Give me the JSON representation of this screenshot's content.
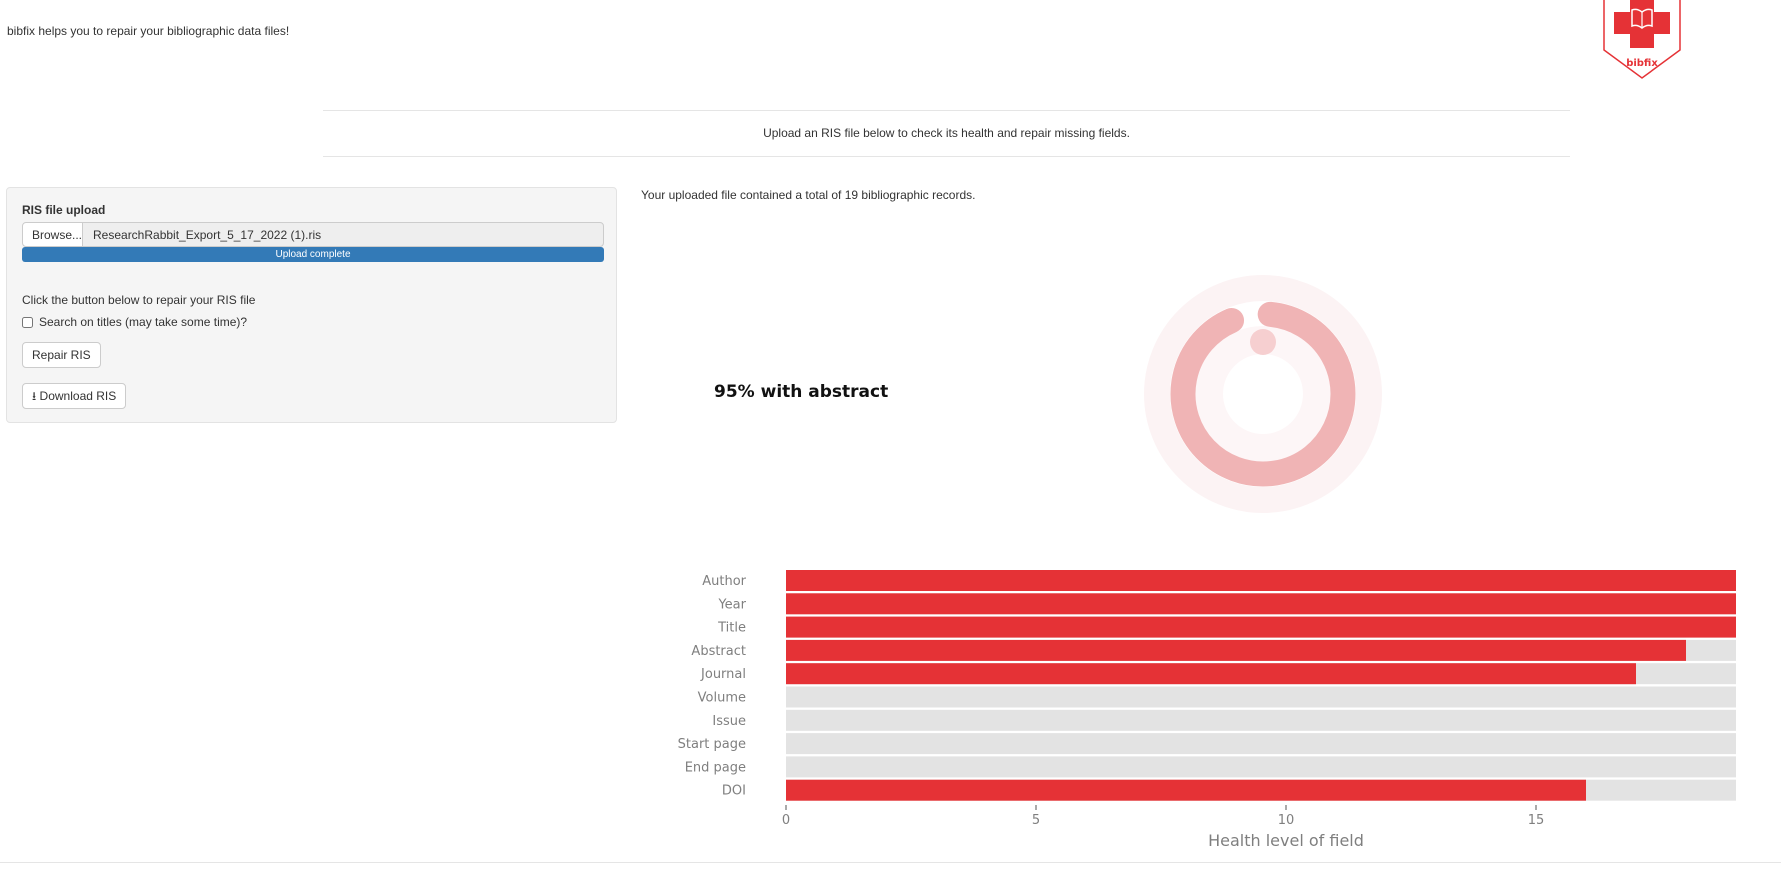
{
  "header": {
    "tagline": "bibfix helps you to repair your bibliographic data files!",
    "logo_text": "bibfix",
    "instructions": "Upload an RIS file below to check its health and repair missing fields."
  },
  "colors": {
    "accent": "#e53236",
    "missing": "#e3e3e3",
    "progress": "#337ab7",
    "donut_ring": "#f0b4b5",
    "donut_track": "#fcf3f4",
    "donut_dot": "#f6cfd0"
  },
  "sidebar": {
    "upload_label": "RIS file upload",
    "browse_label": "Browse...",
    "file_name": "ResearchRabbit_Export_5_17_2022 (1).ris",
    "progress_text": "Upload complete",
    "progress_percent": 100,
    "repair_prompt": "Click the button below to repair your RIS file",
    "checkbox_label": "Search on titles (may take some time)?",
    "checkbox_checked": false,
    "repair_button": "Repair RIS",
    "download_button": "Download RIS",
    "download_icon": "download-icon"
  },
  "main": {
    "records_text": "Your uploaded file contained a total of 19 bibliographic records.",
    "abstract_label": "95% with abstract",
    "abstract_percent": 95
  },
  "chart_data": {
    "type": "bar",
    "orientation": "horizontal",
    "categories": [
      "Author",
      "Year",
      "Title",
      "Abstract",
      "Journal",
      "Volume",
      "Issue",
      "Start page",
      "End page",
      "DOI"
    ],
    "values": [
      19,
      19,
      19,
      18,
      17,
      0,
      0,
      0,
      0,
      16
    ],
    "total": 19,
    "xlabel": "Health level of field",
    "xlim": [
      0,
      20
    ],
    "xticks": [
      "0",
      "5",
      "10",
      "15",
      "2"
    ],
    "grid": false
  }
}
